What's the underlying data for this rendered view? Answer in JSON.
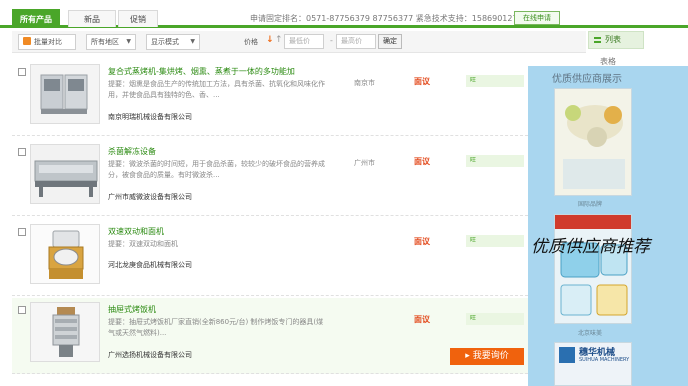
{
  "tabs": [
    {
      "label": "所有产品",
      "active": true
    },
    {
      "label": "新品",
      "active": false
    },
    {
      "label": "促销",
      "active": false
    }
  ],
  "hotline": "申请固定排名：0571-87756379 87756377 紧急技术支持：15869012768",
  "online_label": "在线申请",
  "filters": {
    "compare_label": "批量对比",
    "region_label": "所有地区",
    "mode_label": "显示模式",
    "price_label": "价格",
    "min_placeholder": "最低价",
    "max_placeholder": "最高价",
    "ok_label": "确定"
  },
  "view": {
    "list_label": "列表",
    "grid_label": "表格"
  },
  "products": [
    {
      "title": "复合式蒸烤机-集烘烤、烟熏、蒸煮于一体的多功能加",
      "desc": "提要：烟熏是食品生产的传统加工方法，具有杀菌、抗氧化和风味化作用，并使食品具有独特的色、香、...",
      "company": "南京明瑞机械设备有限公司",
      "city": "南京市",
      "bargain": "面议",
      "chat": "旺"
    },
    {
      "title": "杀菌解冻设备",
      "desc": "提要：微波杀菌的时间短，用于食品杀菌，较较少的破坏食品的营养成分，被食食品的质量。有时微波杀...",
      "company": "广州市威微波设备有限公司",
      "city": "广州市",
      "bargain": "面议",
      "chat": "旺"
    },
    {
      "title": "双速双动和面机",
      "desc": "提要：双速双动和面机",
      "company": "河北龙庚食品机械有限公司",
      "city": "",
      "bargain": "面议",
      "chat": "旺"
    },
    {
      "title": "抽屉式烤饭机",
      "desc": "提要：抽屉式烤饭机厂家直销(全新860元/台) 制作烤饭专门的器具(煤气或天然气燃料)...",
      "company": "广州选扬机械设备有限公司",
      "city": "",
      "bargain": "面议",
      "chat": "旺"
    }
  ],
  "inquiry_label": "我要询价",
  "supplier": {
    "title": "优质供应商展示",
    "cap1": "国际品牌",
    "cap2": "北京味美",
    "overlay": "优质供应商推荐",
    "logo_cn": "穗华机械",
    "logo_en": "SUIHUA MACHINERY"
  },
  "colors": {
    "accent": "#4aa629",
    "price": "#e34b1e",
    "inquiry": "#f0620d",
    "supplier_bg": "#a9d6ef"
  }
}
